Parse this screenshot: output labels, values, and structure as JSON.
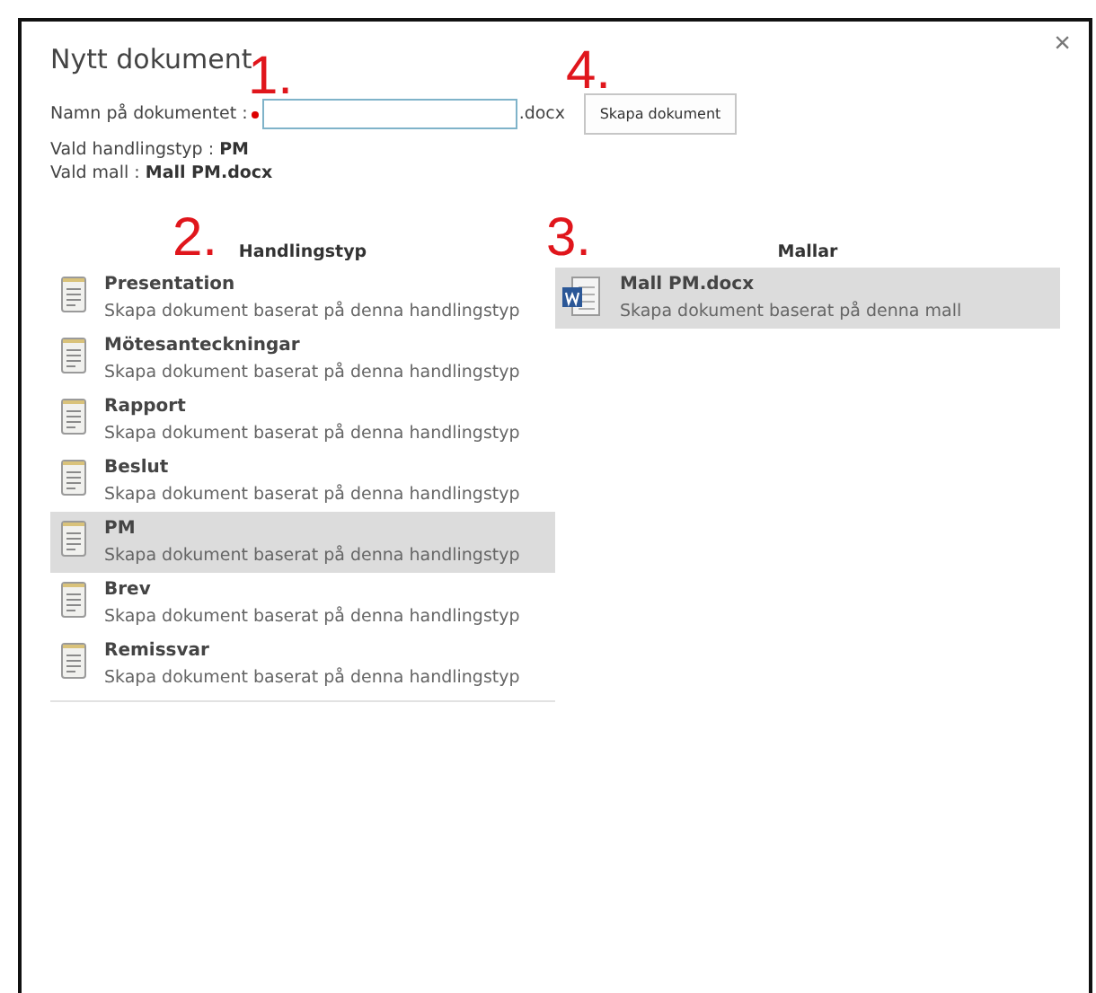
{
  "dialog": {
    "title": "Nytt dokument",
    "close": "×"
  },
  "name_field": {
    "label": "Namn på dokumentet :",
    "required": true,
    "suffix": ".docx"
  },
  "create_button": "Skapa dokument",
  "selected_info": [
    {
      "label": "Vald handlingstyp : ",
      "value": "PM"
    },
    {
      "label": "Vald mall : ",
      "value": "Mall PM.docx"
    }
  ],
  "document_types": {
    "heading": "Handlingstyp",
    "items": [
      {
        "name": "Presentation",
        "description": "Skapa dokument baserat på denna handlingstyp",
        "selected": false
      },
      {
        "name": "Mötesanteckningar",
        "description": "Skapa dokument baserat på denna handlingstyp",
        "selected": false
      },
      {
        "name": "Rapport",
        "description": "Skapa dokument baserat på denna handlingstyp",
        "selected": false
      },
      {
        "name": "Beslut",
        "description": "Skapa dokument baserat på denna handlingstyp",
        "selected": false
      },
      {
        "name": "PM",
        "description": "Skapa dokument baserat på denna handlingstyp",
        "selected": true
      },
      {
        "name": "Brev",
        "description": "Skapa dokument baserat på denna handlingstyp",
        "selected": false
      },
      {
        "name": "Remissvar",
        "description": "Skapa dokument baserat på denna handlingstyp",
        "selected": false
      }
    ]
  },
  "templates": {
    "heading": "Mallar",
    "items": [
      {
        "name": "Mall PM.docx",
        "description": "Skapa dokument baserat på denna mall",
        "selected": true
      }
    ]
  },
  "annotations": [
    "1.",
    "4.",
    "2.",
    "3."
  ]
}
